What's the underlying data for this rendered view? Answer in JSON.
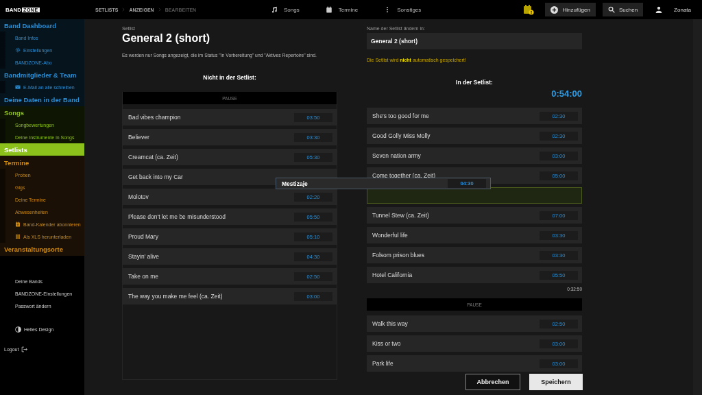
{
  "topbar": {
    "logo": {
      "word": "BAND",
      "boxed": "ZONE"
    },
    "breadcrumbs": [
      {
        "label": "SETLISTS",
        "selected": false
      },
      {
        "label": "ANZEIGEN",
        "selected": false
      },
      {
        "label": "BEARBEITEN",
        "selected": true
      }
    ],
    "nav": [
      {
        "kind": "music",
        "label": "Songs"
      },
      {
        "kind": "calendar",
        "label": "Termine"
      },
      {
        "kind": "dots",
        "label": "Sonstiges"
      }
    ],
    "add_button": "Hinzufügen",
    "search_button": "Suchen",
    "user": "Zonata"
  },
  "sidebar": {
    "sections": [
      {
        "color": "#2a8fd6",
        "items": [
          {
            "kind": "main",
            "label": "Band Dashboard",
            "selected": false
          },
          {
            "kind": "sub",
            "label": "Band Infos",
            "selected": false
          },
          {
            "kind": "sub-settings",
            "label": "Einstellungen",
            "selected": false
          },
          {
            "kind": "sub",
            "label": "BANDZONE-Abo",
            "selected": false
          },
          {
            "kind": "main",
            "label": "Bandmitglieder & Team",
            "selected": false
          },
          {
            "kind": "sub-mail",
            "label": "E-Mail an alle schreiben",
            "selected": false
          },
          {
            "kind": "main",
            "label": "Deine Daten in der Band",
            "selected": false
          }
        ]
      },
      {
        "color": "#8cc01a",
        "items": [
          {
            "kind": "main",
            "label": "Songs",
            "selected": false
          },
          {
            "kind": "sub",
            "label": "Songbewertungen",
            "selected": false
          },
          {
            "kind": "sub",
            "label": "Deine Instrumente in Songs",
            "selected": false
          },
          {
            "kind": "main",
            "label": "Setlists",
            "selected": true
          }
        ]
      },
      {
        "color": "#d08a10",
        "items": [
          {
            "kind": "main",
            "label": "Termine",
            "selected": false
          },
          {
            "kind": "sub",
            "label": "Proben",
            "selected": false
          },
          {
            "kind": "sub",
            "label": "Gigs",
            "selected": false
          },
          {
            "kind": "sub",
            "label": "Deine Termine",
            "selected": false
          },
          {
            "kind": "sub",
            "label": "Abwesenheiten",
            "selected": false
          },
          {
            "kind": "sub-calendar",
            "label": "Band-Kalender abonnieren",
            "selected": false
          },
          {
            "kind": "sub-table",
            "label": "Als XLS herunterladen",
            "selected": false
          },
          {
            "kind": "main",
            "label": "Veranstaltungsorte",
            "selected": false
          }
        ]
      }
    ],
    "footer_links": [
      "Deine Bands",
      "BANDZONE-Einstellungen",
      "Passwort ändern"
    ],
    "theme_toggle": "Helles Design",
    "logout": "Logout"
  },
  "editor": {
    "label": "Setlist",
    "title": "General 2 (short)",
    "info": "Es werden nur Songs angezeigt, die im Status \"In Vorbereitung\" und \"Aktives Repertoire\" sind.",
    "available": {
      "heading": "Nicht in der Setlist:",
      "items": [
        {
          "kind": "pause",
          "label": "PAUSE"
        },
        {
          "kind": "song",
          "title": "Bad vibes champion",
          "time": "03:50"
        },
        {
          "kind": "song",
          "title": "Believer",
          "time": "03:30"
        },
        {
          "kind": "song",
          "title": "Creamcat (ca. Zeit)",
          "time": "05:30"
        },
        {
          "kind": "song",
          "title": "Get back into my Car"
        },
        {
          "kind": "song",
          "title": "Molotov",
          "time": "02:20"
        },
        {
          "kind": "song",
          "title": "Please don't let me be misunderstood",
          "time": "05:50"
        },
        {
          "kind": "song",
          "title": "Proud Mary",
          "time": "05:10"
        },
        {
          "kind": "song",
          "title": "Stayin' alive",
          "time": "04:30"
        },
        {
          "kind": "song",
          "title": "Take on me",
          "time": "02:50"
        },
        {
          "kind": "song",
          "title": "The way you make me feel (ca. Zeit)",
          "time": "03:00"
        }
      ]
    },
    "name_label": "Name der Setlist ändern in:",
    "name_value": "General 2 (short)",
    "warning": "Die Setlist wird **nicht** automatisch gespeichert!",
    "setlist": {
      "heading": "In der Setlist:",
      "total": "0:54:00",
      "items": [
        {
          "kind": "song",
          "title": "She's too good for me",
          "time": "02:30"
        },
        {
          "kind": "song",
          "title": "Good Golly Miss Molly",
          "time": "02:30"
        },
        {
          "kind": "song",
          "title": "Seven nation army",
          "time": "03:00"
        },
        {
          "kind": "song",
          "title": "Come together (ca. Zeit)",
          "time": "05:00"
        },
        {
          "kind": "placeholder"
        },
        {
          "kind": "song",
          "title": "Tunnel Stew (ca. Zeit)",
          "time": "07:00"
        },
        {
          "kind": "song",
          "title": "Wonderful life",
          "time": "03:30"
        },
        {
          "kind": "song",
          "title": "Folsom prison blues",
          "time": "03:30"
        },
        {
          "kind": "song",
          "title": "Hotel California",
          "time": "05:50"
        },
        {
          "kind": "subtotal",
          "label": "0:32:50"
        },
        {
          "kind": "pause",
          "label": "PAUSE"
        },
        {
          "kind": "song",
          "title": "Walk this way",
          "time": "02:50"
        },
        {
          "kind": "song",
          "title": "Kiss or two",
          "time": "03:00"
        },
        {
          "kind": "song",
          "title": "Park life",
          "time": "03:00"
        }
      ]
    },
    "dragged": {
      "title": "Mestizaje",
      "time": "04:30"
    },
    "cancel_button": "Abbrechen",
    "save_button": "Speichern"
  }
}
